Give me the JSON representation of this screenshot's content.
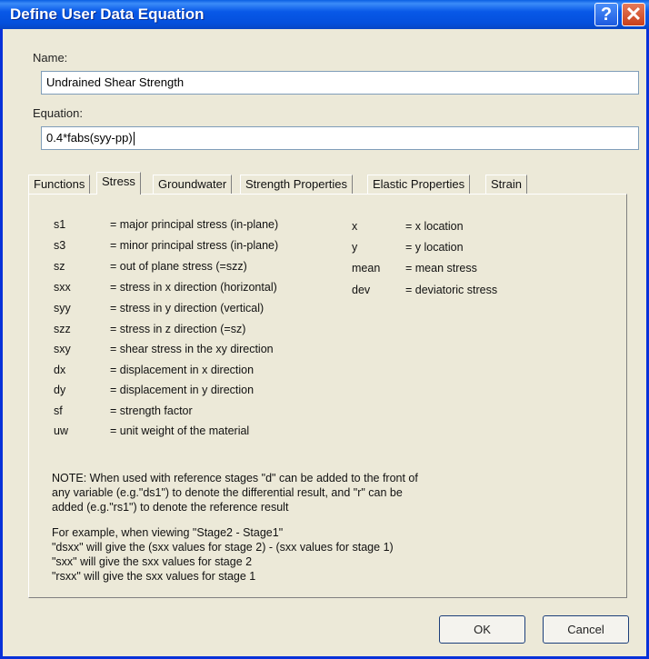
{
  "window": {
    "title": "Define User Data Equation",
    "help_label": "?",
    "close_label": "✕"
  },
  "name": {
    "label": "Name:",
    "value": "Undrained Shear Strength"
  },
  "equation": {
    "label": "Equation:",
    "value": "0.4*fabs(syy-pp)"
  },
  "tabs": [
    {
      "label": "Functions"
    },
    {
      "label": "Stress"
    },
    {
      "label": "Groundwater"
    },
    {
      "label": "Strength Properties"
    },
    {
      "label": "Elastic Properties"
    },
    {
      "label": "Strain"
    }
  ],
  "active_tab": "Stress",
  "variables_left": [
    {
      "name": "s1",
      "desc": "= major principal stress (in-plane)"
    },
    {
      "name": "s3",
      "desc": "= minor principal stress (in-plane)"
    },
    {
      "name": "sz",
      "desc": "= out of plane stress (=szz)"
    },
    {
      "name": "sxx",
      "desc": "= stress in x direction (horizontal)"
    },
    {
      "name": "syy",
      "desc": "= stress in y direction (vertical)"
    },
    {
      "name": "szz",
      "desc": "= stress in z direction (=sz)"
    },
    {
      "name": "sxy",
      "desc": "= shear stress in the xy direction"
    },
    {
      "name": "dx",
      "desc": "= displacement in x direction"
    },
    {
      "name": "dy",
      "desc": "= displacement in y direction"
    },
    {
      "name": "sf",
      "desc": "= strength factor"
    },
    {
      "name": "uw",
      "desc": "= unit weight of the material"
    }
  ],
  "variables_right": [
    {
      "name": "x",
      "desc": "= x location"
    },
    {
      "name": "y",
      "desc": "= y location"
    },
    {
      "name": "mean",
      "desc": "= mean stress"
    },
    {
      "name": "dev",
      "desc": "= deviatoric stress"
    }
  ],
  "note_lines": [
    "NOTE: When used with reference stages \"d\" can be added to the front of",
    "any variable (e.g.\"ds1\") to denote the differential result, and \"r\" can be",
    "added (e.g.\"rs1\") to denote the reference result"
  ],
  "example_lines": [
    "For example, when viewing \"Stage2 - Stage1\"",
    "\"dsxx\" will give the (sxx values for stage 2) - (sxx values for stage 1)",
    "\"sxx\" will give the sxx values for stage 2",
    "\"rsxx\" will give the sxx values for stage 1"
  ],
  "buttons": {
    "ok": "OK",
    "cancel": "Cancel"
  }
}
